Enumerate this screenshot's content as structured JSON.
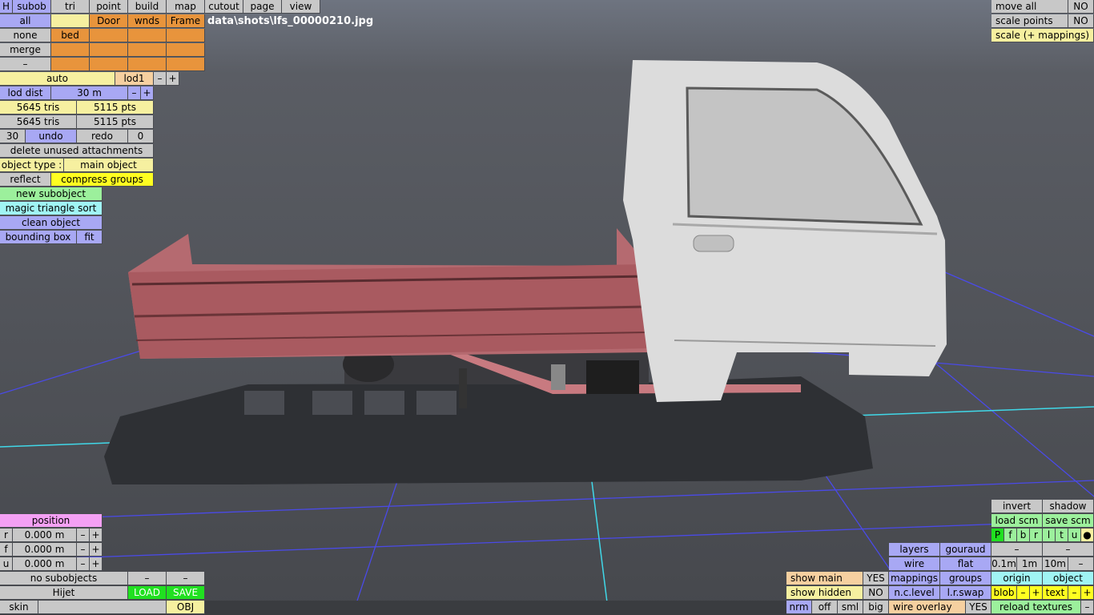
{
  "top_tabs": {
    "h": "H",
    "subob": "subob",
    "tri": "tri",
    "point": "point",
    "build": "build",
    "map": "map",
    "cutout": "cutout",
    "page": "page",
    "view": "view"
  },
  "file_path": "data\\shots\\lfs_00000210.jpg",
  "groups": {
    "all": "all",
    "none": "none",
    "merge": "merge",
    "dash": "–",
    "door": "Door",
    "wnds": "wnds",
    "frame": "Frame",
    "bed": "bed"
  },
  "lod": {
    "auto": "auto",
    "level": "lod1",
    "minus": "–",
    "plus": "+",
    "dist_label": "lod dist",
    "dist_value": "30 m"
  },
  "stats": {
    "tris1": "5645 tris",
    "pts1": "5115 pts",
    "tris2": "5645 tris",
    "pts2": "5115 pts"
  },
  "history": {
    "count": "30",
    "undo": "undo",
    "redo": "redo",
    "redo_count": "0"
  },
  "actions": {
    "delete_unused": "delete unused attachments",
    "object_type_label": "object type :",
    "object_type_value": "main object",
    "reflect": "reflect",
    "compress_groups": "compress groups",
    "new_subobject": "new subobject",
    "magic_sort": "magic triangle sort",
    "clean_object": "clean object",
    "bounding_box": "bounding box",
    "fit": "fit"
  },
  "top_right": {
    "move_all": "move all",
    "move_all_val": "NO",
    "scale_points": "scale points",
    "scale_points_val": "NO",
    "scale_mappings": "scale (+ mappings)"
  },
  "position": {
    "title": "position",
    "r_label": "r",
    "r_value": "0.000 m",
    "f_label": "f",
    "f_value": "0.000 m",
    "u_label": "u",
    "u_value": "0.000 m",
    "minus": "–",
    "plus": "+"
  },
  "bottom_left": {
    "no_subobjects": "no subobjects",
    "dash1": "–",
    "dash2": "–",
    "name": "Hijet",
    "load": "LOAD",
    "save": "SAVE",
    "skin": "skin",
    "obj": "OBJ"
  },
  "bottom_mid": {
    "show_main": "show main",
    "show_main_val": "YES",
    "show_hidden": "show hidden",
    "show_hidden_val": "NO",
    "nrm": "nrm",
    "off": "off",
    "sml": "sml",
    "big": "big"
  },
  "render": {
    "layers": "layers",
    "gouraud": "gouraud",
    "wire": "wire",
    "flat": "flat",
    "mappings": "mappings",
    "groups": "groups",
    "nc_level": "n.c.level",
    "lr_swap": "l.r.swap",
    "wire_overlay": "wire overlay",
    "wire_overlay_val": "YES"
  },
  "right_panel": {
    "invert": "invert",
    "shadow": "shadow",
    "load_scm": "load scm",
    "save_scm": "save scm",
    "views": [
      "P",
      "f",
      "b",
      "r",
      "l",
      "t",
      "u",
      "●"
    ],
    "dash_a": "–",
    "dash_b": "–",
    "g01": "0.1m",
    "g1": "1m",
    "g10": "10m",
    "gminus": "–",
    "origin": "origin",
    "object": "object",
    "blob": "blob",
    "text": "text",
    "minus": "–",
    "plus": "+",
    "reload_textures": "reload textures",
    "reload_minus": "–"
  }
}
